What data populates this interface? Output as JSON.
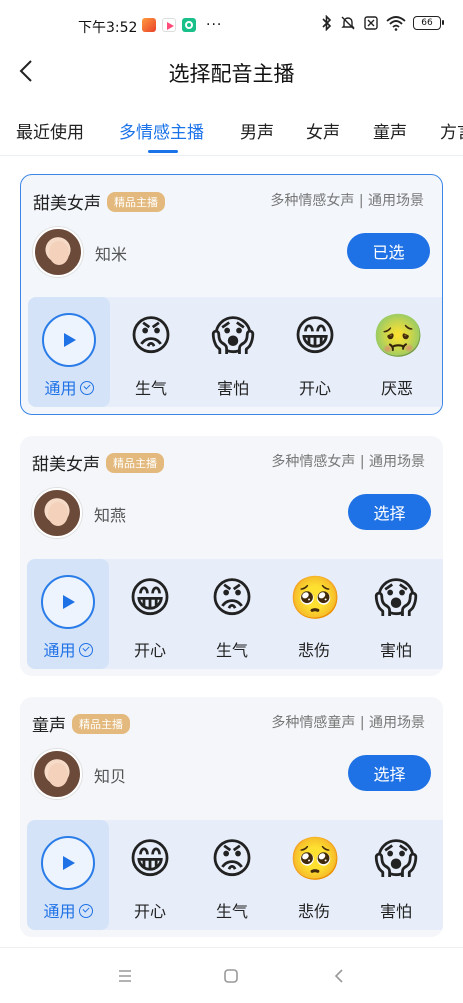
{
  "status_bar": {
    "time": "下午3:52",
    "dots": "···",
    "battery": "66"
  },
  "header": {
    "title": "选择配音主播"
  },
  "tabs": [
    {
      "label": "最近使用",
      "active": false
    },
    {
      "label": "多情感主播",
      "active": true
    },
    {
      "label": "男声",
      "active": false
    },
    {
      "label": "女声",
      "active": false
    },
    {
      "label": "童声",
      "active": false
    },
    {
      "label": "方言",
      "active": false
    }
  ],
  "cards": [
    {
      "category": "甜美女声",
      "badge": "精品主播",
      "description": "多种情感女声 | 通用场景",
      "voice_name": "知米",
      "button_label": "已选",
      "selected": true,
      "emotions": [
        {
          "label": "通用",
          "type": "play"
        },
        {
          "label": "生气",
          "icon": "angry-face-icon",
          "glyph": "😡"
        },
        {
          "label": "害怕",
          "icon": "scared-face-icon",
          "glyph": "😱"
        },
        {
          "label": "开心",
          "icon": "grinning-face-icon",
          "glyph": "😁"
        },
        {
          "label": "厌恶",
          "icon": "nauseated-face-icon",
          "glyph": "🤢"
        }
      ]
    },
    {
      "category": "甜美女声",
      "badge": "精品主播",
      "description": "多种情感女声 | 通用场景",
      "voice_name": "知燕",
      "button_label": "选择",
      "selected": false,
      "emotions": [
        {
          "label": "通用",
          "type": "play"
        },
        {
          "label": "开心",
          "icon": "grinning-face-icon",
          "glyph": "😁"
        },
        {
          "label": "生气",
          "icon": "angry-face-icon",
          "glyph": "😡"
        },
        {
          "label": "悲伤",
          "icon": "pleading-face-icon",
          "glyph": "🥺"
        },
        {
          "label": "害怕",
          "icon": "scared-face-icon",
          "glyph": "😱"
        }
      ]
    },
    {
      "category": "童声",
      "badge": "精品主播",
      "description": "多种情感童声 | 通用场景",
      "voice_name": "知贝",
      "button_label": "选择",
      "selected": false,
      "emotions": [
        {
          "label": "通用",
          "type": "play"
        },
        {
          "label": "开心",
          "icon": "grinning-face-icon",
          "glyph": "😁"
        },
        {
          "label": "生气",
          "icon": "angry-face-icon",
          "glyph": "😡"
        },
        {
          "label": "悲伤",
          "icon": "pleading-face-icon",
          "glyph": "🥺"
        },
        {
          "label": "害怕",
          "icon": "scared-face-icon",
          "glyph": "😱"
        }
      ]
    }
  ],
  "colors": {
    "accent": "#1f72e6",
    "badge": "#e3b97d",
    "card_bg": "#f4f6f9",
    "strip_bg": "#e7eef9"
  }
}
